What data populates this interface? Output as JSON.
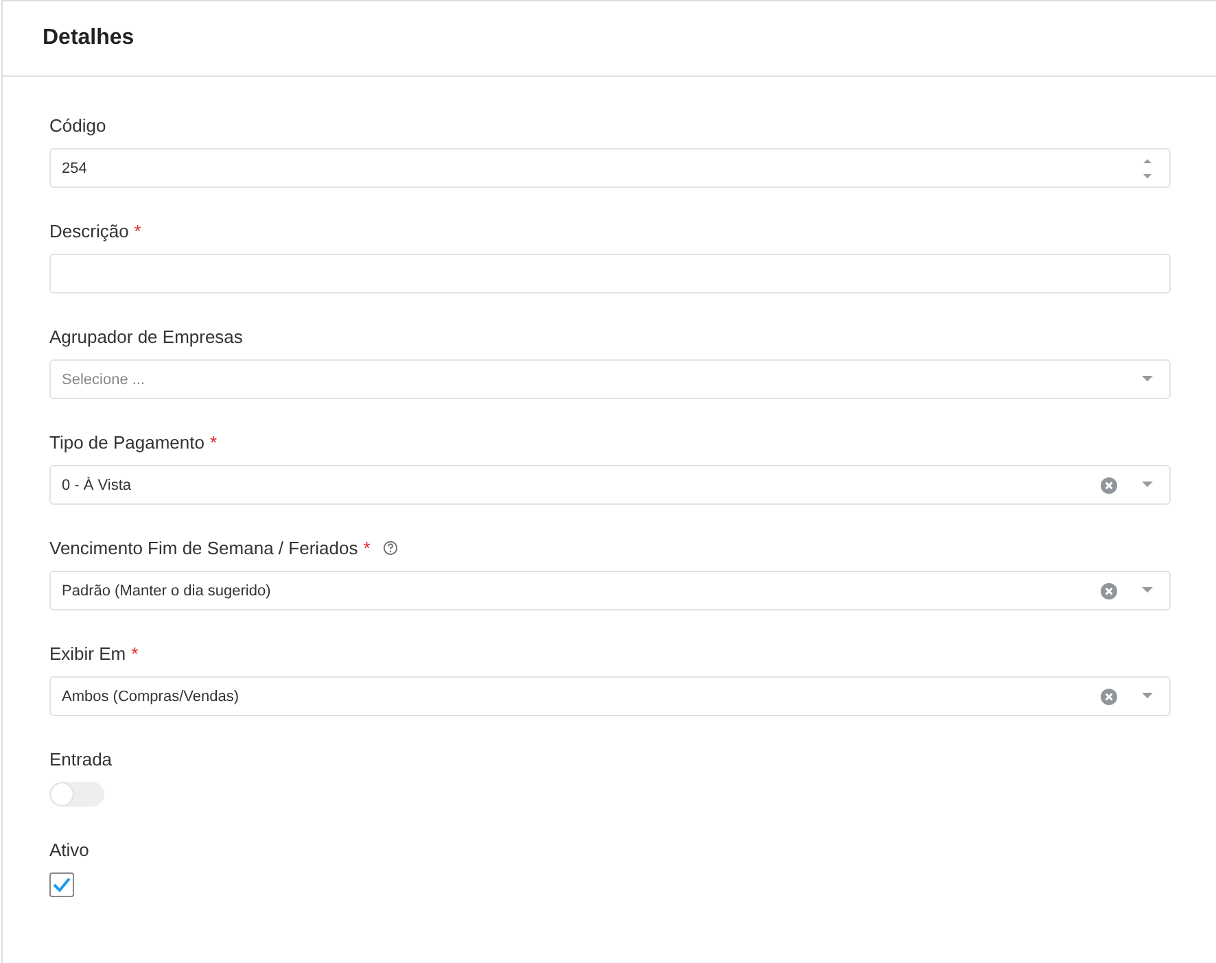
{
  "panel": {
    "title": "Detalhes"
  },
  "fields": [
    {
      "kind": "number",
      "label": "Código",
      "value": "254"
    },
    {
      "kind": "text",
      "label": "Descrição",
      "required_mark": "*"
    },
    {
      "kind": "select",
      "label": "Agrupador de Empresas",
      "placeholder": "Selecione ..."
    },
    {
      "kind": "select",
      "label": "Tipo de Pagamento",
      "required_mark": "*",
      "value": "0 - À Vista",
      "clearable": true
    },
    {
      "kind": "select",
      "label": "Vencimento Fim de Semana / Feriados",
      "required_mark": "*",
      "help": true,
      "value": "Padrão (Manter o dia sugerido)",
      "clearable": true
    },
    {
      "kind": "select",
      "label": "Exibir Em",
      "required_mark": "*",
      "value": "Ambos (Compras/Vendas)",
      "clearable": true
    },
    {
      "kind": "toggle",
      "label": "Entrada",
      "on": false
    },
    {
      "kind": "checkbox",
      "label": "Ativo",
      "checked": true
    }
  ]
}
